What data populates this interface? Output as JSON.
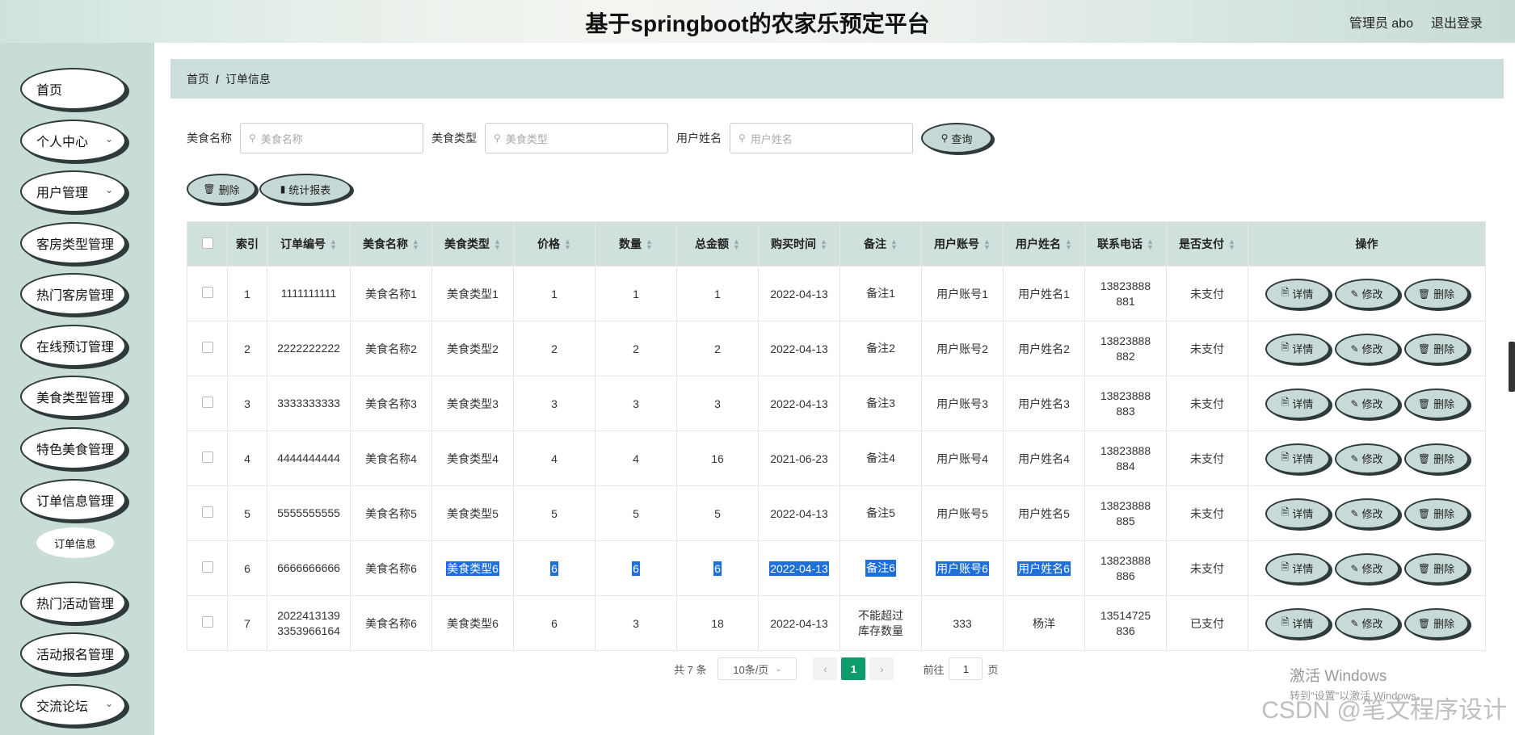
{
  "header": {
    "title": "基于springboot的农家乐预定平台",
    "admin": "管理员 abo",
    "logout": "退出登录"
  },
  "sidebar": {
    "items": [
      {
        "label": "首页",
        "chev": false
      },
      {
        "label": "个人中心",
        "chev": true
      },
      {
        "label": "用户管理",
        "chev": true
      },
      {
        "label": "客房类型管理",
        "chev": false
      },
      {
        "label": "热门客房管理",
        "chev": false
      },
      {
        "label": "在线预订管理",
        "chev": false
      },
      {
        "label": "美食类型管理",
        "chev": false
      },
      {
        "label": "特色美食管理",
        "chev": false
      },
      {
        "label": "订单信息管理",
        "chev": false
      },
      {
        "label": "热门活动管理",
        "chev": false
      },
      {
        "label": "活动报名管理",
        "chev": false
      },
      {
        "label": "交流论坛",
        "chev": true
      }
    ],
    "sub_item": "订单信息"
  },
  "breadcrumb": {
    "home": "首页",
    "sep": "/",
    "current": "订单信息"
  },
  "search": {
    "fields": [
      {
        "label": "美食名称",
        "placeholder": "美食名称"
      },
      {
        "label": "美食类型",
        "placeholder": "美食类型"
      },
      {
        "label": "用户姓名",
        "placeholder": "用户姓名"
      }
    ],
    "button": "查询"
  },
  "actions": {
    "delete": "删除",
    "report": "统计报表"
  },
  "table": {
    "columns": [
      "索引",
      "订单编号",
      "美食名称",
      "美食类型",
      "价格",
      "数量",
      "总金额",
      "购买时间",
      "备注",
      "用户账号",
      "用户姓名",
      "联系电话",
      "是否支付",
      "操作"
    ],
    "rows": [
      [
        "1",
        "1111111111",
        "美食名称1",
        "美食类型1",
        "1",
        "1",
        "1",
        "2022-04-13",
        "备注1",
        "用户账号1",
        "用户姓名1",
        "13823888881",
        "未支付"
      ],
      [
        "2",
        "2222222222",
        "美食名称2",
        "美食类型2",
        "2",
        "2",
        "2",
        "2022-04-13",
        "备注2",
        "用户账号2",
        "用户姓名2",
        "13823888882",
        "未支付"
      ],
      [
        "3",
        "3333333333",
        "美食名称3",
        "美食类型3",
        "3",
        "3",
        "3",
        "2022-04-13",
        "备注3",
        "用户账号3",
        "用户姓名3",
        "13823888883",
        "未支付"
      ],
      [
        "4",
        "4444444444",
        "美食名称4",
        "美食类型4",
        "4",
        "4",
        "16",
        "2021-06-23",
        "备注4",
        "用户账号4",
        "用户姓名4",
        "13823888884",
        "未支付"
      ],
      [
        "5",
        "5555555555",
        "美食名称5",
        "美食类型5",
        "5",
        "5",
        "5",
        "2022-04-13",
        "备注5",
        "用户账号5",
        "用户姓名5",
        "13823888885",
        "未支付"
      ],
      [
        "6",
        "6666666666",
        "美食名称6",
        "美食类型6",
        "6",
        "6",
        "6",
        "2022-04-13",
        "备注6",
        "用户账号6",
        "用户姓名6",
        "13823888886",
        "未支付"
      ],
      [
        "7",
        "20224131393353966164",
        "美食名称6",
        "美食类型6",
        "6",
        "3",
        "18",
        "2022-04-13",
        "不能超过库存数量",
        "333",
        "杨洋",
        "13514725836",
        "已支付"
      ]
    ],
    "highlighted_row": 5,
    "row_buttons": {
      "detail": "详情",
      "edit": "修改",
      "delete": "删除"
    }
  },
  "pagination": {
    "total": "共 7 条",
    "page_size": "10条/页",
    "current_page": "1",
    "goto_label": "前往",
    "goto_value": "1",
    "page_unit": "页"
  },
  "watermark": {
    "line1": "激活 Windows",
    "line2": "转到\"设置\"以激活 Windows。",
    "csdn": "CSDN @笔文程序设计"
  },
  "colors": {
    "sidebar_bg": "#c8dcd8",
    "header_row_bg": "#cfe0dd",
    "active_page": "#0e9b6d",
    "highlight": "#1e6fd9"
  }
}
